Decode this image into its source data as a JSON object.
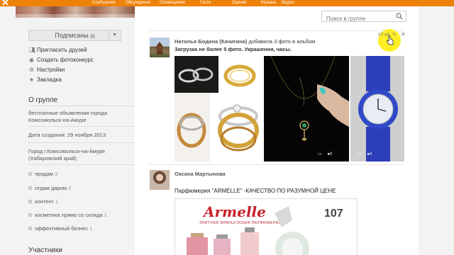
{
  "topnav": {
    "items": [
      "Сообщения",
      "Обсуждения",
      "Оповещения",
      "Гости",
      "Оценки",
      "Музыка",
      "Видео"
    ]
  },
  "sidebar": {
    "subscribed_label": "Подписаны",
    "actions": [
      {
        "label": "Пригласить друзей",
        "icon": "people-icon"
      },
      {
        "label": "Создать фотоконкурс",
        "icon": "camera-icon"
      },
      {
        "label": "Настройки",
        "icon": "gear-icon"
      },
      {
        "label": "Закладка",
        "icon": "star-icon"
      }
    ],
    "about_title": "О группе",
    "description": "бесплатные объявления города Комсомольск-на-Амуре",
    "created": "Дата создания: 29 ноября 2013",
    "location": "Город г.Комсомольск-на-Амуре (Хабаровский край)",
    "tags": [
      {
        "label": "продам",
        "count": "3"
      },
      {
        "label": "отдам даром",
        "count": "2"
      },
      {
        "label": "контент",
        "count": "1"
      },
      {
        "label": "косметика прямо со склада",
        "count": "1"
      },
      {
        "label": "эффективный бизнес",
        "count": "1"
      }
    ],
    "members_title": "Участники"
  },
  "search": {
    "placeholder": "Поиск в группе"
  },
  "posts": [
    {
      "author": "Наталья Бодина (Качигина)",
      "action": "добавила 3 фото в альбом",
      "caption": "Загрузка не более 5 фото. Украшения, часы.",
      "time": "07:48",
      "photos": [
        {
          "subject": "rings",
          "likes": "0"
        },
        {
          "subject": "necklace",
          "likes": "0"
        },
        {
          "subject": "watch",
          "likes": "0"
        }
      ]
    },
    {
      "author": "Оксана Мартынова",
      "text": "Парфюмерия \"ARMELLE\"  -КАЧЕСТВО ПО РАЗУМНОЙ ЦЕНЕ",
      "ad": {
        "brand": "Armelle",
        "subtitle": "ЭЛИТНАЯ ФРАНЦУЗСКАЯ ПАРФЮМЕРИЯ",
        "number": "107"
      }
    }
  ],
  "colors": {
    "brand": "#ee8208",
    "link": "#666666",
    "ad_red": "#c7202b"
  }
}
